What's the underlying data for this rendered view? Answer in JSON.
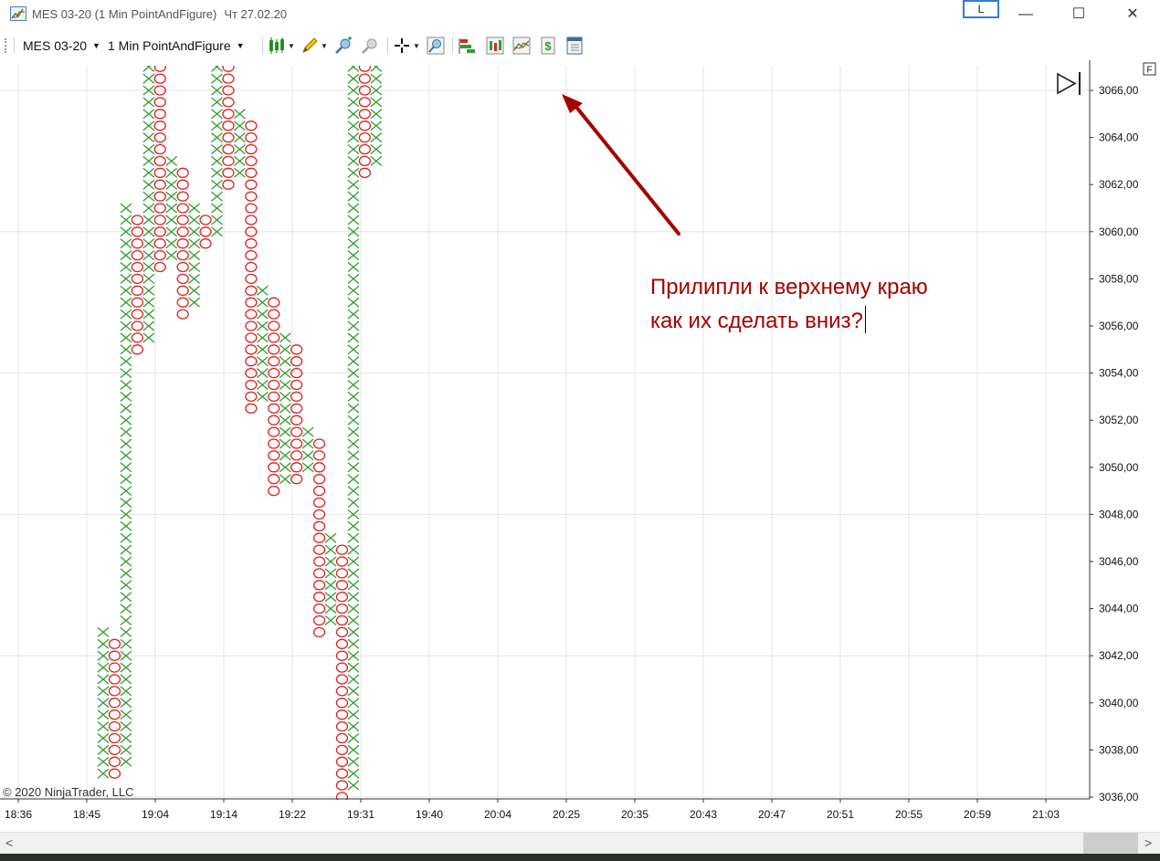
{
  "window": {
    "title": "MES 03-20 (1 Min PointAndFigure)",
    "date": "Чт 27.02.20",
    "link_label": "L",
    "minimize": "—",
    "maximize": "☐",
    "close": "✕"
  },
  "toolbar": {
    "instrument": "MES 03-20",
    "interval": "1 Min PointAndFigure",
    "caret": "▼",
    "icons": [
      "bar-type-icon",
      "drawing-tool-icon",
      "zoom-in-icon",
      "zoom-out-icon",
      "crosshair-icon",
      "magnifier-icon",
      "strategy-icon",
      "indicators-icon",
      "chart-style-icon",
      "dollar-icon",
      "properties-icon"
    ]
  },
  "chart": {
    "copyright": "© 2020 NinjaTrader, LLC",
    "right_margin_label": "F",
    "annotation_line1": "Прилипли к верхнему краю",
    "annotation_line2": "как их сделать вниз?",
    "colors": {
      "x": "#2e9e2e",
      "o": "#e02222",
      "grid": "#e4e4e4",
      "arrow": "#a50000",
      "annotation": "#a50000"
    }
  },
  "chart_data": {
    "type": "point-and-figure",
    "box_size": 0.5,
    "y_ticks": [
      "3036,00",
      "3038,00",
      "3040,00",
      "3042,00",
      "3044,00",
      "3046,00",
      "3048,00",
      "3050,00",
      "3052,00",
      "3054,00",
      "3056,00",
      "3058,00",
      "3060,00",
      "3062,00",
      "3064,00",
      "3066,00"
    ],
    "y_tick_values": [
      3036,
      3038,
      3040,
      3042,
      3044,
      3046,
      3048,
      3050,
      3052,
      3054,
      3056,
      3058,
      3060,
      3062,
      3064,
      3066
    ],
    "x_ticks": [
      "18:36",
      "18:45",
      "19:04",
      "19:14",
      "19:22",
      "19:31",
      "19:40",
      "20:04",
      "20:25",
      "20:35",
      "20:43",
      "20:47",
      "20:51",
      "20:55",
      "20:59",
      "21:03"
    ],
    "ylim": [
      3035.8,
      3067.2
    ],
    "columns": [
      {
        "type": "X",
        "low": 3037.0,
        "high": 3043.0
      },
      {
        "type": "O",
        "low": 3037.0,
        "high": 3042.5
      },
      {
        "type": "X",
        "low": 3037.5,
        "high": 3061.0
      },
      {
        "type": "O",
        "low": 3055.0,
        "high": 3060.5
      },
      {
        "type": "X",
        "low": 3055.5,
        "high": 3067.0
      },
      {
        "type": "O",
        "low": 3058.5,
        "high": 3067.0
      },
      {
        "type": "X",
        "low": 3059.0,
        "high": 3063.0
      },
      {
        "type": "O",
        "low": 3056.5,
        "high": 3062.5
      },
      {
        "type": "X",
        "low": 3057.0,
        "high": 3061.0
      },
      {
        "type": "O",
        "low": 3059.5,
        "high": 3060.5
      },
      {
        "type": "X",
        "low": 3060.0,
        "high": 3067.0
      },
      {
        "type": "O",
        "low": 3062.0,
        "high": 3067.0
      },
      {
        "type": "X",
        "low": 3062.5,
        "high": 3065.0
      },
      {
        "type": "O",
        "low": 3052.5,
        "high": 3064.5
      },
      {
        "type": "X",
        "low": 3053.0,
        "high": 3057.5
      },
      {
        "type": "O",
        "low": 3049.0,
        "high": 3057.0
      },
      {
        "type": "X",
        "low": 3049.5,
        "high": 3055.5
      },
      {
        "type": "O",
        "low": 3049.5,
        "high": 3055.0
      },
      {
        "type": "X",
        "low": 3050.0,
        "high": 3051.5
      },
      {
        "type": "O",
        "low": 3043.0,
        "high": 3051.0
      },
      {
        "type": "X",
        "low": 3043.5,
        "high": 3047.0
      },
      {
        "type": "O",
        "low": 3036.0,
        "high": 3046.5
      },
      {
        "type": "X",
        "low": 3036.5,
        "high": 3067.0
      },
      {
        "type": "O",
        "low": 3062.5,
        "high": 3067.0
      },
      {
        "type": "X",
        "low": 3063.0,
        "high": 3067.0
      }
    ]
  }
}
